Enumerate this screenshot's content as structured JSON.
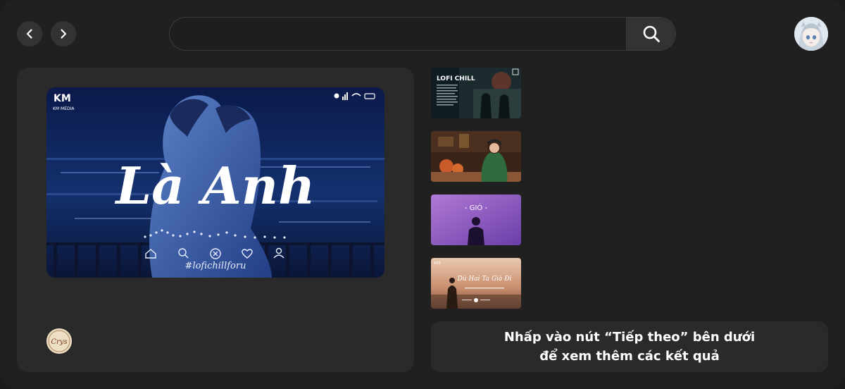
{
  "header": {
    "back_icon": "chevron-left-icon",
    "forward_icon": "chevron-right-icon",
    "search": {
      "value": "",
      "placeholder": "",
      "button_icon": "search-icon"
    },
    "avatar_icon": "anime-girl-avatar"
  },
  "main_result": {
    "thumbnail": {
      "brand": "KM MEDIA",
      "title_text": "Là Anh",
      "hashtag": "#lofichillforu"
    },
    "channel_logo_text": "Crys"
  },
  "side_results": [
    {
      "overlay_text": "LOFI CHILL"
    },
    {
      "overlay_text": ""
    },
    {
      "overlay_text": "- GIÓ -"
    },
    {
      "overlay_text": "Dù Hai Ta Già Đi"
    }
  ],
  "next_prompt": {
    "line1": "Nhấp vào nút “Tiếp theo” bên dưới",
    "line2": "để xem thêm các kết quả"
  },
  "colors": {
    "background": "#202020",
    "panel": "#2a2a2a",
    "button": "#333333",
    "text": "#ffffff"
  }
}
